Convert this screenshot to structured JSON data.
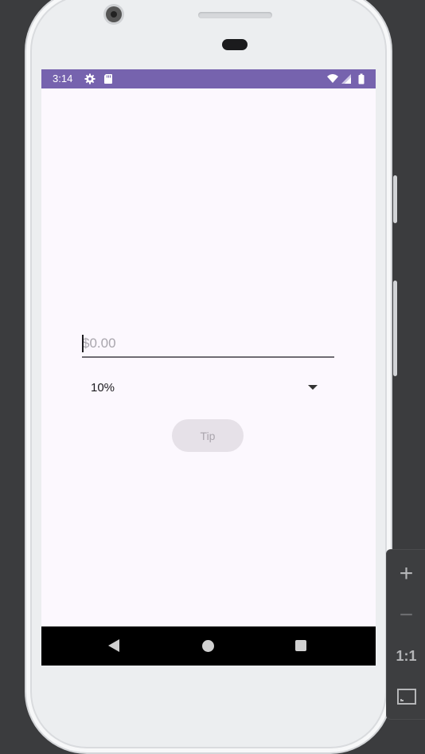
{
  "status_bar": {
    "time": "3:14",
    "icons": [
      "gear-icon",
      "sd-card-icon",
      "wifi-icon",
      "signal-icon",
      "battery-icon"
    ],
    "color": "#7663ae"
  },
  "app": {
    "amount_placeholder": "$0.00",
    "amount_value": "",
    "tip_percent": "10%",
    "tip_button_label": "Tip",
    "tip_button_enabled": false,
    "background": "#fcf8fe"
  },
  "navigation": {
    "buttons": [
      "back-icon",
      "home-icon",
      "recents-icon"
    ]
  },
  "zoom_controls": {
    "plus_label": "+",
    "minus_label": "−",
    "actual_size_label": "1:1",
    "fit_icon": "fit-screen-icon"
  }
}
